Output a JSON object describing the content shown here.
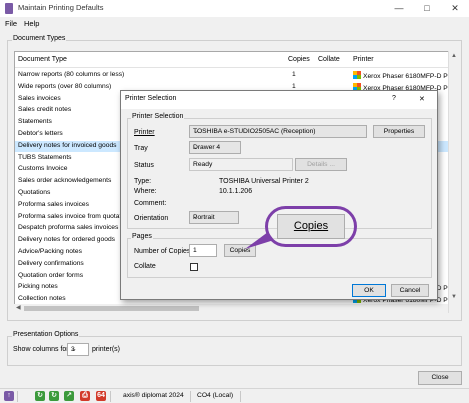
{
  "window": {
    "title": "Maintain Printing Defaults"
  },
  "menu": [
    "File",
    "Help"
  ],
  "document_types": {
    "group_label": "Document Types",
    "columns": [
      "Document Type",
      "Copies",
      "Collate",
      "Printer"
    ],
    "rows": [
      {
        "type": "Narrow reports (80 columns or less)",
        "copies": "1",
        "printer": "Xerox Phaser 6180MFP-D PCL 6",
        "icon": true
      },
      {
        "type": "Wide reports (over 80 columns)",
        "copies": "1",
        "printer": "Xerox Phaser 6180MFP-D PCL 6",
        "icon": true
      },
      {
        "type": "Sales invoices",
        "copies": "",
        "printer": "",
        "icon": false
      },
      {
        "type": "Sales credit notes",
        "copies": "",
        "printer": "",
        "icon": false
      },
      {
        "type": "Statements",
        "copies": "",
        "printer": "",
        "icon": false
      },
      {
        "type": "Debtor's letters",
        "copies": "",
        "printer": "",
        "icon": false
      },
      {
        "type": "Delivery notes for invoiced goods",
        "copies": "",
        "printer": "",
        "icon": false
      },
      {
        "type": "TUBS Statements",
        "copies": "",
        "printer": "",
        "icon": false
      },
      {
        "type": "Customs Invoice",
        "copies": "",
        "printer": "",
        "icon": false
      },
      {
        "type": "Sales order acknowledgements",
        "copies": "",
        "printer": "",
        "icon": false
      },
      {
        "type": "Quotations",
        "copies": "",
        "printer": "",
        "icon": false
      },
      {
        "type": "Proforma sales invoices",
        "copies": "",
        "printer": "",
        "icon": false
      },
      {
        "type": "Proforma sales invoice from quotation",
        "copies": "",
        "printer": "",
        "icon": false
      },
      {
        "type": "Despatch proforma sales invoices",
        "copies": "",
        "printer": "",
        "icon": false
      },
      {
        "type": "Delivery notes for ordered goods",
        "copies": "",
        "printer": "",
        "icon": false
      },
      {
        "type": "Advice/Packing notes",
        "copies": "",
        "printer": "",
        "icon": false
      },
      {
        "type": "Delivery confirmations",
        "copies": "",
        "printer": "",
        "icon": false
      },
      {
        "type": "Quotation order forms",
        "copies": "",
        "printer": "",
        "icon": false
      },
      {
        "type": "Picking notes",
        "copies": "1",
        "printer": "Xerox Phaser 6180MFP-D PCL 6",
        "icon": true
      },
      {
        "type": "Collection notes",
        "copies": "1",
        "printer": "Xerox Phaser 6180MFP-D PCL 6",
        "icon": true
      }
    ],
    "right_truncations": [
      "6",
      "6",
      "6",
      "6",
      "6",
      "6",
      "6",
      "6",
      "6",
      "6",
      "6",
      "6",
      "6",
      "6",
      "6",
      "6"
    ]
  },
  "presentation": {
    "group_label": "Presentation Options",
    "show_label": "Show columns for",
    "columns_value": "3",
    "suffix": "printer(s)"
  },
  "close_label": "Close",
  "dialog": {
    "title": "Printer Selection",
    "help": "?",
    "close": "✕",
    "printer_group": "Printer Selection",
    "printer_label": "Printer",
    "printer_value": "TOSHIBA e-STUDIO2505AC (Reception)",
    "properties_label": "Properties",
    "tray_label": "Tray",
    "tray_value": "Drawer 4",
    "status_label": "Status",
    "status_value": "Ready",
    "details_label": "Details ...",
    "type_label": "Type:",
    "type_value": "TOSHIBA Universal Printer 2",
    "where_label": "Where:",
    "where_value": "10.1.1.206",
    "comment_label": "Comment:",
    "orientation_label": "Orientation",
    "orientation_value": "Portrait",
    "pages_group": "Pages",
    "copies_label": "Number of Copies",
    "copies_value": "1",
    "copies_button": "Copies",
    "collate_label": "Collate",
    "ok_label": "OK",
    "cancel_label": "Cancel"
  },
  "callout_label": "Copies",
  "status": {
    "app": "axis® diplomat 2024",
    "company": "CO4 (Local)"
  },
  "colors": {
    "accent": "#7d3fa9",
    "selection": "#cce8ff"
  }
}
